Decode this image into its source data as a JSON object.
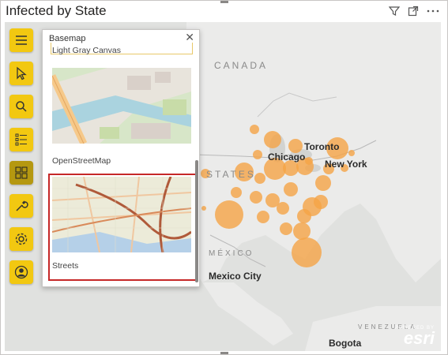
{
  "visual": {
    "title": "Infected by State"
  },
  "header_icons": [
    "filter-icon",
    "focus-mode-icon",
    "more-options-icon"
  ],
  "toolbar": {
    "buttons": [
      {
        "name": "menu",
        "icon": "hamburger-icon"
      },
      {
        "name": "select",
        "icon": "cursor-icon"
      },
      {
        "name": "search",
        "icon": "search-icon"
      },
      {
        "name": "layers",
        "icon": "layer-list-icon"
      },
      {
        "name": "basemap",
        "icon": "basemap-gallery-icon",
        "active": true
      },
      {
        "name": "tools",
        "icon": "wrench-icon"
      },
      {
        "name": "settings",
        "icon": "gear-icon"
      },
      {
        "name": "account",
        "icon": "user-icon"
      }
    ]
  },
  "basemap_panel": {
    "title": "Basemap",
    "close_glyph": "✕",
    "options": [
      {
        "label": "Light Gray Canvas"
      },
      {
        "label": "OpenStreetMap"
      },
      {
        "label": "Streets",
        "selected": true
      }
    ]
  },
  "map": {
    "labels": {
      "canada": "CANADA",
      "states": "STATES",
      "mexico": "MÉXICO",
      "venezuela": "VENEZUELA",
      "chicago": "Chicago",
      "toronto": "Toronto",
      "new_york": "New York",
      "mexico_city": "Mexico City",
      "bogota": "Bogota"
    },
    "bubble_color": "#f5a446"
  },
  "attribution": {
    "powered_by": "POWERED BY",
    "brand": "esri"
  },
  "colors": {
    "toolbar_yellow": "#f2c811",
    "selection_red": "#c62828"
  }
}
